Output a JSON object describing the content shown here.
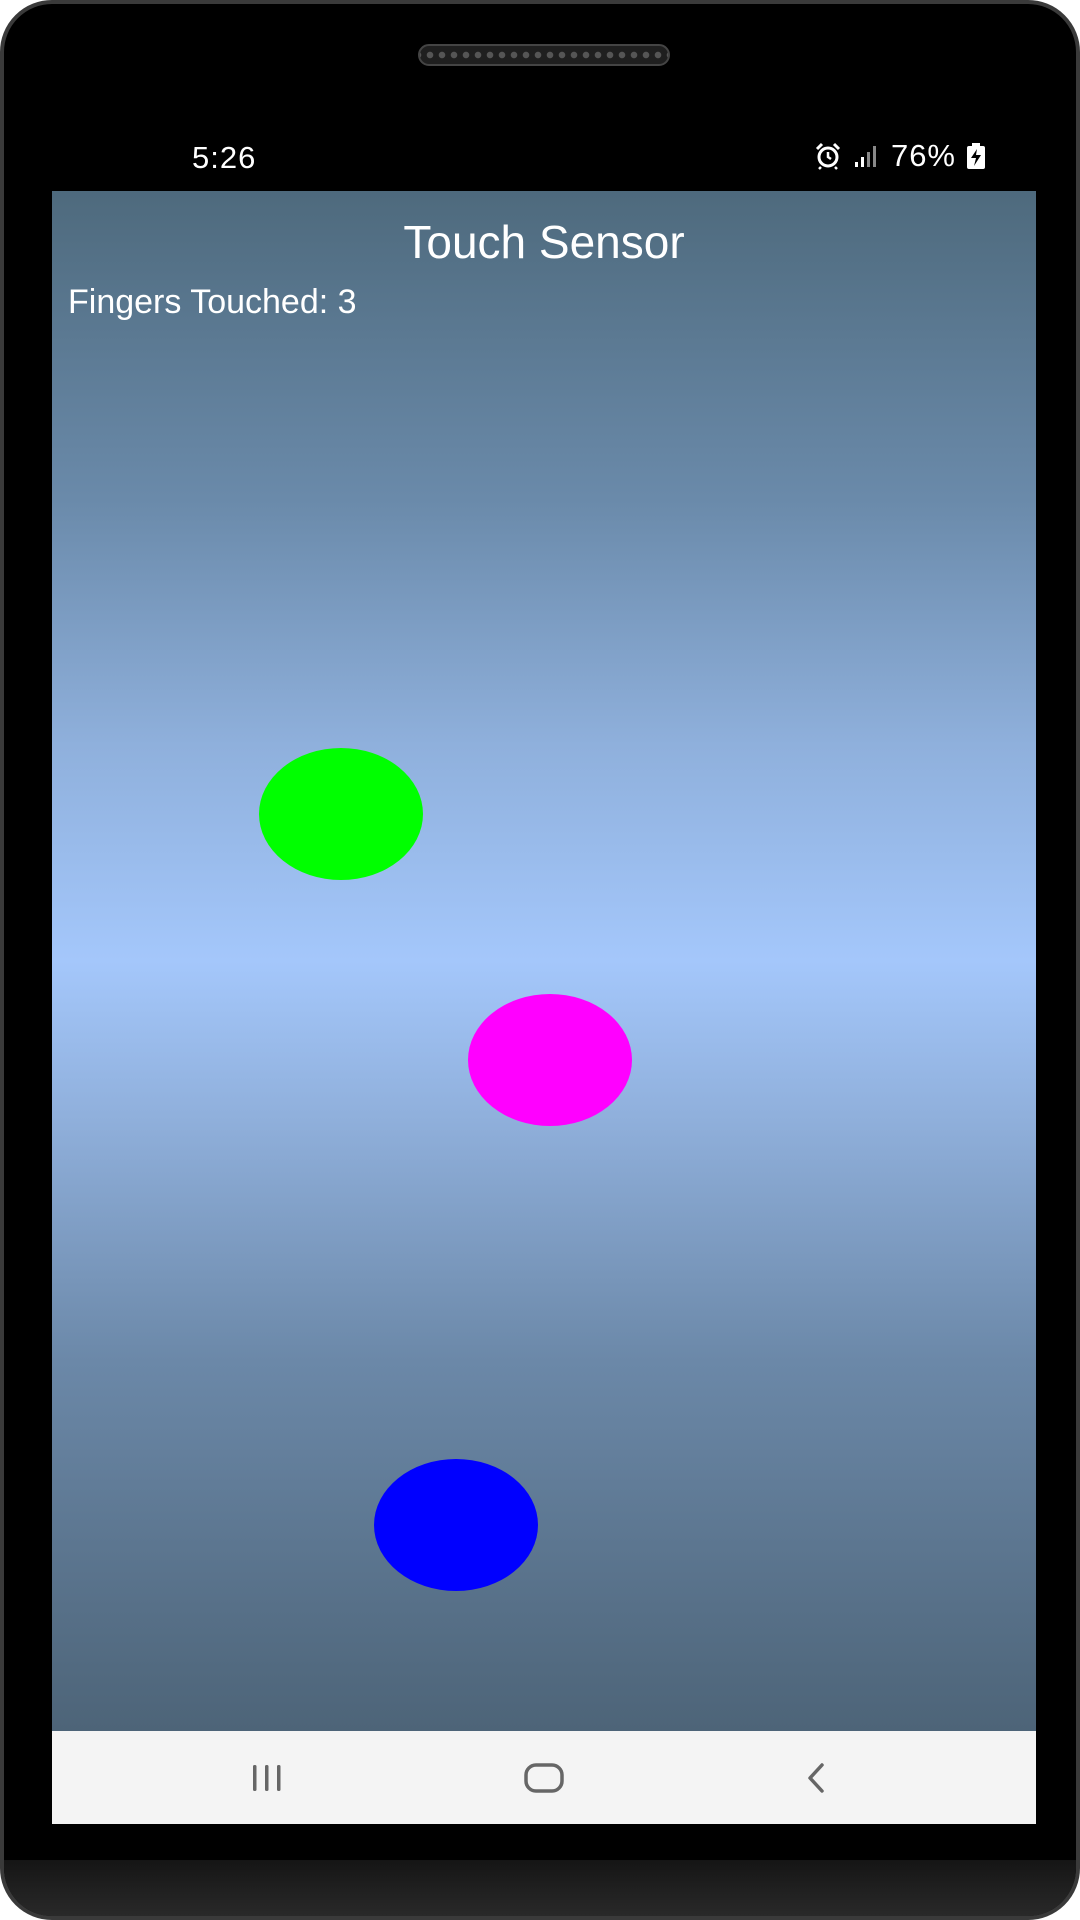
{
  "status_bar": {
    "time": "5:26",
    "battery": "76%",
    "icons": [
      "alarm-icon",
      "signal-icon",
      "battery-charging-icon"
    ]
  },
  "app": {
    "title": "Touch Sensor",
    "fingers_label": "Fingers Touched: 3"
  },
  "touch_points": [
    {
      "color": "#00ff00"
    },
    {
      "color": "#ff00ff"
    },
    {
      "color": "#0000ff"
    }
  ],
  "nav_bar": {
    "buttons": [
      "recent-apps-icon",
      "home-icon",
      "back-icon"
    ]
  }
}
